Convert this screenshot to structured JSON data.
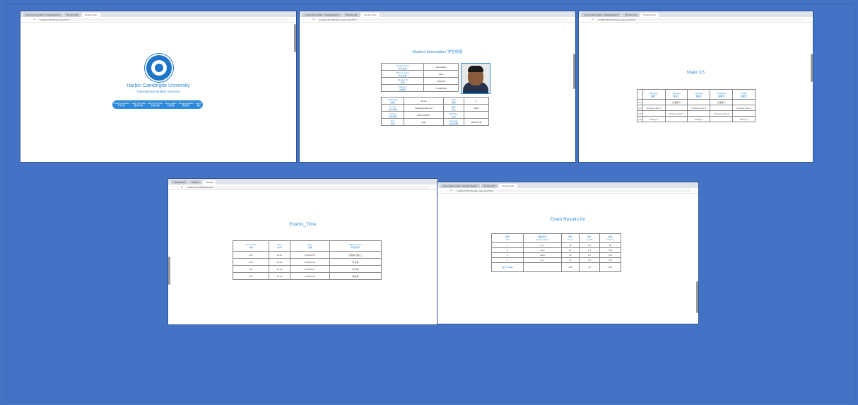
{
  "window1": {
    "tabs": [
      "Lorem ipsum dolor - Google Search",
      "Sit amet elit",
      "Student login"
    ],
    "url": "localhost:5173/index.aspx?id=3",
    "university": "Harbin Cambrigde University",
    "subtitle": "International Student Services",
    "nav": [
      {
        "en": "Student Information",
        "zh": "学生信息"
      },
      {
        "en": "Class Time Table",
        "zh": "课程时间表"
      },
      {
        "en": "Exams Time Table",
        "zh": "考试时间表"
      },
      {
        "en": "Exams results",
        "zh": "考试成绩"
      },
      {
        "en": "Change password",
        "zh": "修改密码"
      },
      {
        "en": "Log out",
        "zh": "退出"
      }
    ]
  },
  "window2": {
    "tabs": [
      "Lorem ipsum dolor - Google Search",
      "Sit amet elit",
      "Student login"
    ],
    "url": "localhost:5173/student_page.aspx?id=3",
    "heading": "Student Information",
    "heading_zh": "学生信息",
    "rows_top": [
      {
        "label": "Student name",
        "label_zh": "学生姓名",
        "value": "Cao Hasan"
      },
      {
        "label": "Chinese name",
        "label_zh": "中文姓名",
        "value": "Sami"
      },
      {
        "label": "Student ID",
        "label_zh": "学号",
        "value": "2023123"
      },
      {
        "label": "Passport",
        "label_zh": "护照号",
        "value": "P00000000"
      }
    ],
    "rows_bottom": [
      {
        "l1": "Nationality",
        "l1zh": "国籍",
        "v1": "Yemen",
        "l2": "Class",
        "l2zh": "班级",
        "v2": "2"
      },
      {
        "l1": "E-mail",
        "l1zh": "电子邮箱",
        "v1": "hasan@gmail.com",
        "l2": "Major",
        "l2zh": "专业",
        "v2": "Math"
      },
      {
        "l1": "Phone",
        "l1zh": "手机号码",
        "v1": "0183 0918077",
        "l2": "Birthday",
        "l2zh": "生日",
        "v2": ""
      },
      {
        "l1": "Sex",
        "l1zh": "性别",
        "v1": "male",
        "l2": "Visa date",
        "l2zh": "签证到期",
        "v2": "2025-06-30"
      }
    ]
  },
  "window3": {
    "tabs": [
      "Lorem ipsum dolor - Google Search",
      "Sit amet elit",
      "Student login"
    ],
    "url": "localhost:5173/student_page.aspx?id=3",
    "heading": "Major CS",
    "days": [
      {
        "en": "Monday",
        "zh": "星期一"
      },
      {
        "en": "Tuesday",
        "zh": "星期二"
      },
      {
        "en": "Monday",
        "zh": "星期三"
      },
      {
        "en": "Thursday",
        "zh": "星期四"
      },
      {
        "en": "Friday",
        "zh": "星期五"
      }
    ],
    "rows": [
      [
        "1-2",
        "",
        "汉语课 B",
        "",
        "汉语课 B",
        ""
      ],
      [
        "3-4",
        "Chinese class 3",
        "",
        "Chinese class 3",
        "",
        "Chinese class 3"
      ],
      [
        "5-6",
        "",
        "Chinese class 3",
        "",
        "Chinese class 3",
        ""
      ],
      [
        "7-8",
        "Writing 1",
        "",
        "Writing 1",
        "",
        "Writing 1"
      ]
    ]
  },
  "window4": {
    "tabs": [
      "Student Info",
      "Exams",
      "Results"
    ],
    "url": "localhost:5173/exams.aspx",
    "heading": "Exams_Time",
    "headers": [
      {
        "en": "Exam Hall",
        "zh": "考场"
      },
      {
        "en": "Time",
        "zh": "时间"
      },
      {
        "en": "Date",
        "zh": "日期"
      },
      {
        "en": "Subject name",
        "zh": "科目名称"
      }
    ],
    "rows": [
      [
        "202",
        "09:00",
        "2023/01/15",
        "汉语综合课(上)"
      ],
      [
        "203",
        "09:00",
        "2023/01/16",
        "听说课"
      ],
      [
        "202",
        "09:00",
        "2023/01/17",
        "写作课"
      ],
      [
        "202",
        "09:00",
        "2023/01/18",
        "阅读课"
      ]
    ]
  },
  "window5": {
    "tabs": [
      "Lorem ipsum dolor - Google Search",
      "Sit amet elit",
      "Student login"
    ],
    "url": "localhost:5173/results_page.aspx?id=3",
    "heading": "Exam Results for",
    "headers": [
      {
        "zh": "编号",
        "en": "NO"
      },
      {
        "zh": "课程名称",
        "en": "Course Name"
      },
      {
        "zh": "课时",
        "en": "Times"
      },
      {
        "zh": "学分",
        "en": "Credits"
      },
      {
        "zh": "成绩",
        "en": "Grades"
      }
    ],
    "rows": [
      [
        "1",
        "C++",
        "32",
        "2.0",
        "90"
      ],
      [
        "2",
        "Java",
        "32",
        "2.2",
        "100"
      ],
      [
        "3",
        "Math",
        "32",
        "2.0",
        "100"
      ],
      [
        "4",
        "C++",
        "32",
        "3.2",
        "100"
      ]
    ],
    "total": [
      "总计 TotalE",
      "",
      "128",
      "10",
      "390"
    ]
  }
}
